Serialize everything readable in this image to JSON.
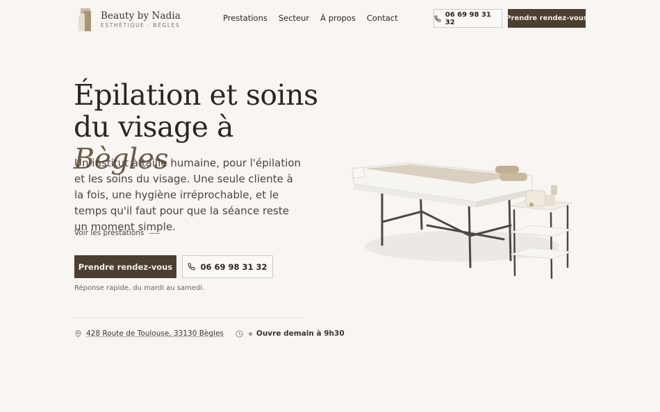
{
  "brand": {
    "name": "Beauty by Nadia",
    "tagline": "ESTHÉTIQUE · BÈGLES"
  },
  "nav": {
    "items": [
      {
        "label": "Prestations"
      },
      {
        "label": "Secteur"
      },
      {
        "label": "À propos"
      },
      {
        "label": "Contact"
      }
    ]
  },
  "header": {
    "phone_label": "06 69 98 31 32",
    "cta_label": "Prendre rendez-vous"
  },
  "hero": {
    "title_line1": "Épilation et soins",
    "title_line2": "du visage à ",
    "title_accent": "Bègles",
    "lead": "Un institut à taille humaine, pour l'épilation et les soins du visage. Une seule cliente à la fois, une hygiène irréprochable, et le temps qu'il faut pour que la séance reste un moment simple.",
    "more_link": "Voir les prestations",
    "primary_button": "Prendre rendez-vous",
    "phone_button": "06 69 98 31 32",
    "note": "Réponse rapide, du mardi au samedi."
  },
  "info": {
    "address": "428 Route de Toulouse, 33130 Bègles",
    "hours_status": "Ouvre demain à 9h30"
  },
  "icons": {
    "phone": "phone-icon",
    "pin": "map-pin-icon",
    "clock": "clock-icon"
  },
  "colors": {
    "background": "#f8f5f2",
    "accent_dark": "#4a3f31",
    "accent_text": "#6b5d4b"
  }
}
